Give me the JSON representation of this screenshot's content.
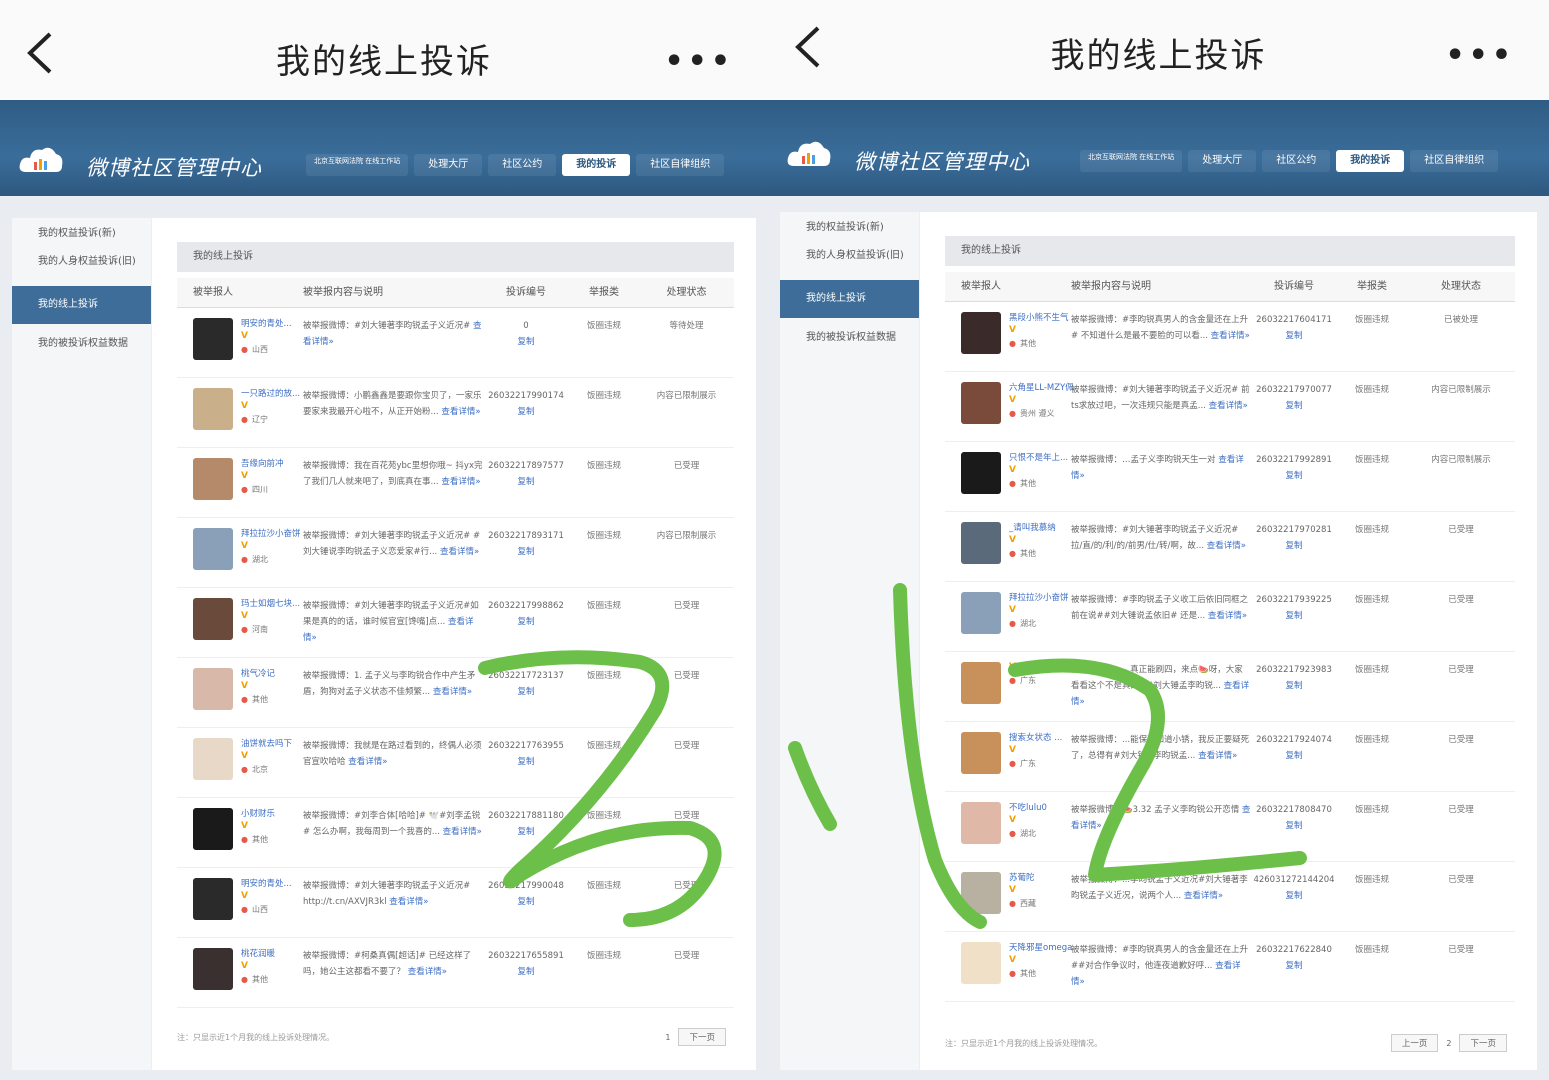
{
  "left": {
    "title": "我的线上投诉",
    "brand": "微博社区管理中心",
    "nav": [
      "北京互联网法院 在线工作站",
      "处理大厅",
      "社区公约",
      "我的投诉",
      "社区自律组织"
    ],
    "sidebar": [
      "我的权益投诉(新)",
      "我的人身权益投诉(旧)",
      "我的线上投诉",
      "我的被投诉权益数据"
    ],
    "main_head": "我的线上投诉",
    "columns": [
      "被举报人",
      "被举报内容与说明",
      "投诉编号",
      "举报类",
      "处理状态"
    ],
    "rows": [
      {
        "user": "明安的青处...",
        "loc": "山西",
        "desc": "被举报微博：#刘大锤著李昀锐孟子义近况# ",
        "more": "查看详情»",
        "id": "0",
        "copy": "复制",
        "type": "饭圈违规",
        "status": "等待处理",
        "avatar": "#2a2a2a"
      },
      {
        "user": "一只路过的放...",
        "loc": "辽宁",
        "desc": "被举报微博：小鹏鑫鑫是要跟你宝贝了，一家乐要家来我最开心啦不，从正开始粉...",
        "more": "查看详情»",
        "id": "26032217990174",
        "copy": "复制",
        "type": "饭圈违规",
        "status": "内容已限制展示",
        "avatar": "#c9b08a"
      },
      {
        "user": "吾缘向前冲",
        "loc": "四川",
        "desc": "被举报微博：我在百花苑ybc里想你哦~ 抖yx完了我们几人就来吧了，到底真在事...",
        "more": "查看详情»",
        "id": "26032217897577",
        "copy": "复制",
        "type": "饭圈违规",
        "status": "已受理",
        "avatar": "#b48a6a"
      },
      {
        "user": "拜拉拉沙小奋饼",
        "loc": "湖北",
        "desc": "被举报微博：#刘大锤著李昀锐孟子义近况# #刘大锤说李昀锐孟子义恋爱家#行...",
        "more": "查看详情»",
        "id": "26032217893171",
        "copy": "复制",
        "type": "饭圈违规",
        "status": "内容已限制展示",
        "avatar": "#8aa0b8"
      },
      {
        "user": "玛士如烟七块...",
        "loc": "河南",
        "desc": "被举报微博：#刘大锤著李昀锐孟子义近况#如果是真的的话，谁时候官宣[馋嘴]点...",
        "more": "查看详情»",
        "id": "26032217998862",
        "copy": "复制",
        "type": "饭圈违规",
        "status": "已受理",
        "avatar": "#6a4a3a"
      },
      {
        "user": "桃气冷记",
        "loc": "其他",
        "desc": "被举报微博：1. 孟子义与李昀锐合作中产生矛盾，狗狗对孟子义状态不佳频繁...",
        "more": "查看详情»",
        "id": "26032217723137",
        "copy": "复制",
        "type": "饭圈违规",
        "status": "已受理",
        "avatar": "#d8b8a8"
      },
      {
        "user": "油饼就去吗下",
        "loc": "北京",
        "desc": "被举报微博：我就是在路过看到的，终偶人必须官宣吹哈哈",
        "more": "查看详情»",
        "id": "26032217763955",
        "copy": "复制",
        "type": "饭圈违规",
        "status": "已受理",
        "avatar": "#e8d8c8"
      },
      {
        "user": "小财财乐",
        "loc": "其他",
        "desc": "被举报微博：#刘李合体[哈哈]# 🕊️#刘李孟锐# 怎么办啊，我每周到一个我喜的...",
        "more": "查看详情»",
        "id": "26032217881180",
        "copy": "复制",
        "type": "饭圈违规",
        "status": "已受理",
        "avatar": "#1a1a1a"
      },
      {
        "user": "明安的青处...",
        "loc": "山西",
        "desc": "被举报微博：#刘大锤著李昀锐孟子义近况# http://t.cn/AXVJR3kl",
        "more": "查看详情»",
        "id": "26032217990048",
        "copy": "复制",
        "type": "饭圈违规",
        "status": "已受理",
        "avatar": "#2a2a2a"
      },
      {
        "user": "桃花润暖",
        "loc": "其他",
        "desc": "被举报微博：#柯桑真偶[超话]# 已经这样了吗，她公主这都看不要了？",
        "more": "查看详情»",
        "id": "26032217655891",
        "copy": "复制",
        "type": "饭圈违规",
        "status": "已受理",
        "avatar": "#3a3030"
      }
    ],
    "footer_note": "注：只显示近1个月我的线上投诉处理情况。",
    "page": "1",
    "next": "下一页"
  },
  "right": {
    "title": "我的线上投诉",
    "brand": "微博社区管理中心",
    "nav": [
      "北京互联网法院 在线工作站",
      "处理大厅",
      "社区公约",
      "我的投诉",
      "社区自律组织"
    ],
    "sidebar": [
      "我的权益投诉(新)",
      "我的人身权益投诉(旧)",
      "我的线上投诉",
      "我的被投诉权益数据"
    ],
    "main_head": "我的线上投诉",
    "columns": [
      "被举报人",
      "被举报内容与说明",
      "投诉编号",
      "举报类",
      "处理状态"
    ],
    "rows": [
      {
        "user": "黑段小熊不生气",
        "loc": "其他",
        "desc": "被举报微博：#李昀锐真男人的含金量还在上升# 不知道什么是最不要脸的可以看...",
        "more": "查看详情»",
        "id": "26032217604171",
        "copy": "复制",
        "type": "饭圈违规",
        "status": "已被处理",
        "avatar": "#3a2a2a"
      },
      {
        "user": "六角星LL-MZY佩",
        "loc": "贵州 遵义",
        "desc": "被举报微博：#刘大锤著李昀锐孟子义近况# 前ts求放过吧，一次违规只能是真孟...",
        "more": "查看详情»",
        "id": "26032217970077",
        "copy": "复制",
        "type": "饭圈违规",
        "status": "内容已限制展示",
        "avatar": "#7a4a3a"
      },
      {
        "user": "只恨不是年上...",
        "loc": "其他",
        "desc": "被举报微博：…孟子义李昀锐天生一对",
        "more": "查看详情»",
        "id": "26032217992891",
        "copy": "复制",
        "type": "饭圈违规",
        "status": "内容已限制展示",
        "avatar": "#1a1a1a"
      },
      {
        "user": "_请叫我慕纳",
        "loc": "其他",
        "desc": "被举报微博：#刘大锤著李昀锐孟子义近况# 拉/直/的/利/的/前男/仕/转/啊，故...",
        "more": "查看详情»",
        "id": "26032217970281",
        "copy": "复制",
        "type": "饭圈违规",
        "status": "已受理",
        "avatar": "#5a6a7a"
      },
      {
        "user": "拜拉拉沙小奋饼",
        "loc": "湖北",
        "desc": "被举报微博：#李昀锐孟子义收工后依旧同框之前在说##刘大锤说孟依旧# 还是...",
        "more": "查看详情»",
        "id": "26032217939225",
        "copy": "复制",
        "type": "饭圈违规",
        "status": "已受理",
        "avatar": "#8aa0b8"
      },
      {
        "user": "",
        "loc": "广东",
        "desc": "被举报微博：...真正能刷四，来点🍉呀，大家看看这个不是真的? #刘大锤孟李昀锐...",
        "more": "查看详情»",
        "id": "26032217923983",
        "copy": "复制",
        "type": "饭圈违规",
        "status": "已受理",
        "avatar": "#c8905a"
      },
      {
        "user": "搜索女状态 ...",
        "loc": "广东",
        "desc": "被举报微博：...能保不知道小锈，我反正要疑死了，总得有#刘大锤#李昀锐孟...",
        "more": "查看详情»",
        "id": "26032217924074",
        "copy": "复制",
        "type": "饭圈违规",
        "status": "已受理",
        "avatar": "#c8905a"
      },
      {
        "user": "不吃lulu0",
        "loc": "湖北",
        "desc": "被举报微博：🍉3.32 孟子义李昀锐公开恋情",
        "more": "查看详情»",
        "id": "26032217808470",
        "copy": "复制",
        "type": "饭圈违规",
        "status": "已受理",
        "avatar": "#e0b8a8"
      },
      {
        "user": "苏葡陀",
        "loc": "西藏",
        "desc": "被举报微博：...李昀锐孟子义近况#刘大锤著李昀锐孟子义近况，说两个人...",
        "more": "查看详情»",
        "id": "426031272144204",
        "copy": "复制",
        "type": "饭圈违规",
        "status": "已受理",
        "avatar": "#b8b0a0"
      },
      {
        "user": "天降邪星omega",
        "loc": "其他",
        "desc": "被举报微博：#李昀锐真男人的含金量还在上升##对合作争议时，他连夜道歉好呼...",
        "more": "查看详情»",
        "id": "26032217622840",
        "copy": "复制",
        "type": "饭圈违规",
        "status": "已受理",
        "avatar": "#f0e0c8"
      }
    ],
    "footer_note": "注：只显示近1个月我的线上投诉处理情况。",
    "prev": "上一页",
    "page": "2",
    "next": "下一页"
  },
  "colors": {
    "banner": "#3a6d9a",
    "link": "#3d6ec4",
    "scribble": "#6cc04a",
    "vbadge": "#f0a000"
  }
}
